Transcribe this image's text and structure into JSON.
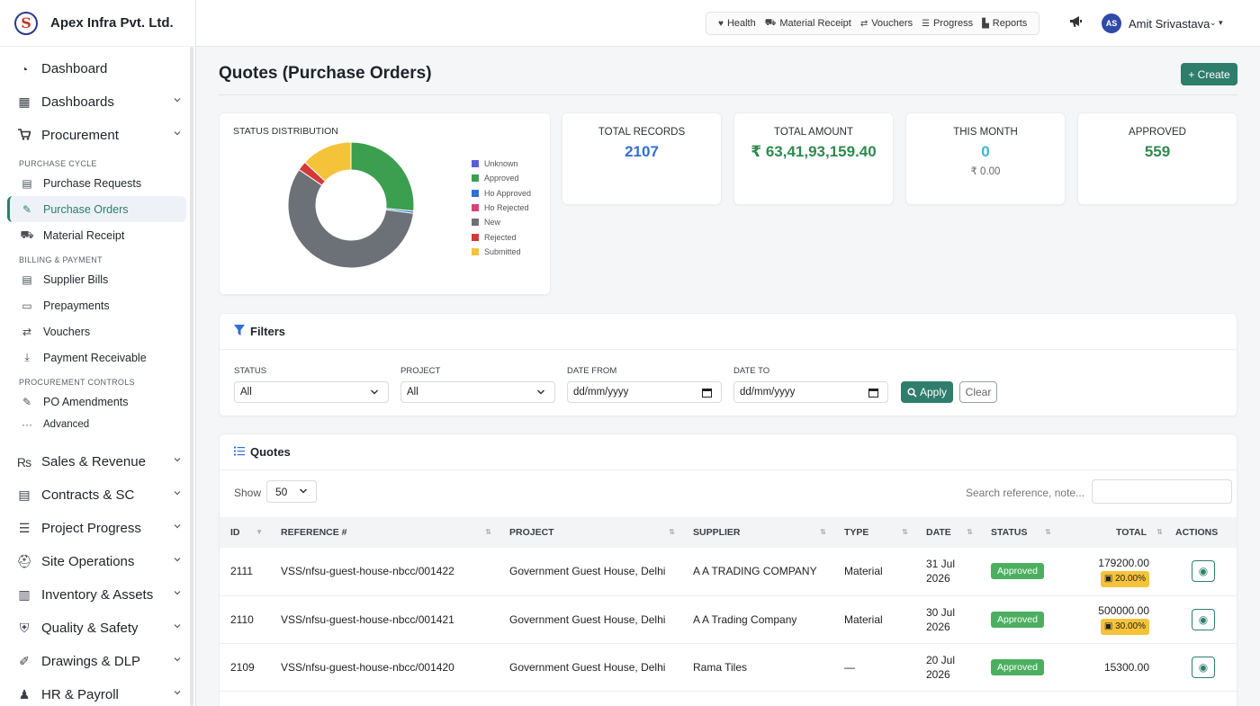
{
  "brand": {
    "name": "Apex Infra Pvt. Ltd.",
    "logo_letter": "S"
  },
  "sidebar": {
    "top": [
      {
        "label": "Dashboard",
        "icon": "gauge-icon",
        "glyph": "◔"
      },
      {
        "label": "Dashboards",
        "icon": "grid-icon",
        "glyph": "▦"
      },
      {
        "label": "Procurement",
        "icon": "cart-icon",
        "glyph": "🛒"
      }
    ],
    "sections": {
      "purchase_cycle": "PURCHASE CYCLE",
      "billing_payment": "BILLING & PAYMENT",
      "procurement_controls": "PROCUREMENT CONTROLS"
    },
    "purchase_cycle_items": [
      {
        "label": "Purchase Requests",
        "glyph": "▤"
      },
      {
        "label": "Purchase Orders",
        "glyph": "✎"
      },
      {
        "label": "Material Receipt",
        "glyph": "⛟"
      }
    ],
    "billing_items": [
      {
        "label": "Supplier Bills",
        "glyph": "▤"
      },
      {
        "label": "Prepayments",
        "glyph": "▭"
      },
      {
        "label": "Vouchers",
        "glyph": "⇄"
      },
      {
        "label": "Payment Receivable",
        "glyph": "⤓"
      }
    ],
    "controls_items": [
      {
        "label": "PO Amendments",
        "glyph": "✎"
      },
      {
        "label": "Advanced",
        "glyph": "···"
      }
    ],
    "bottom": [
      {
        "label": "Sales & Revenue",
        "glyph": "₨"
      },
      {
        "label": "Contracts & SC",
        "glyph": "▤"
      },
      {
        "label": "Project Progress",
        "glyph": "☰"
      },
      {
        "label": "Site Operations",
        "glyph": "⛑"
      },
      {
        "label": "Inventory & Assets",
        "glyph": "▥"
      },
      {
        "label": "Quality & Safety",
        "glyph": "⛨"
      },
      {
        "label": "Drawings & DLP",
        "glyph": "✐"
      },
      {
        "label": "HR & Payroll",
        "glyph": "♟"
      }
    ]
  },
  "header": {
    "quick_links": [
      {
        "label": "Health",
        "glyph": "♥"
      },
      {
        "label": "Material Receipt",
        "glyph": "⛟"
      },
      {
        "label": "Vouchers",
        "glyph": "⇄"
      },
      {
        "label": "Progress",
        "glyph": "☰"
      },
      {
        "label": "Reports",
        "glyph": "▙"
      }
    ],
    "user_initials": "AS",
    "user_name": "Amit Srivastava"
  },
  "page": {
    "title": "Quotes (Purchase Orders)",
    "create_label": "+ Create"
  },
  "status_chart": {
    "title": "STATUS DISTRIBUTION",
    "slices": [
      {
        "label": "Unknown",
        "value": 0,
        "color": "#5b5fd6"
      },
      {
        "label": "Approved",
        "value": 559,
        "color": "#3c9e4f"
      },
      {
        "label": "Ho Approved",
        "value": 12,
        "color": "#2f6fd6"
      },
      {
        "label": "Ho Rejected",
        "value": 0,
        "color": "#d6437a"
      },
      {
        "label": "New",
        "value": 1210,
        "color": "#6c7178"
      },
      {
        "label": "Rejected",
        "value": 50,
        "color": "#d23a3a"
      },
      {
        "label": "Submitted",
        "value": 276,
        "color": "#f5c33a"
      }
    ]
  },
  "stats": [
    {
      "label": "TOTAL RECORDS",
      "value": "2107",
      "color": "#2f6fd6",
      "sub": ""
    },
    {
      "label": "TOTAL AMOUNT",
      "value": "₹ 63,41,93,159.40",
      "color": "#2f8a4e",
      "sub": ""
    },
    {
      "label": "THIS MONTH",
      "value": "0",
      "color": "#3ab4d8",
      "sub": "₹ 0.00"
    },
    {
      "label": "APPROVED",
      "value": "559",
      "color": "#2f8a4e",
      "sub": ""
    }
  ],
  "filters": {
    "title": "Filters",
    "status_label": "STATUS",
    "status_value": "All",
    "project_label": "PROJECT",
    "project_value": "All",
    "date_from_label": "DATE FROM",
    "date_from_placeholder": "dd/mm/yyyy",
    "date_to_label": "DATE TO",
    "date_to_placeholder": "dd/mm/yyyy",
    "apply_label": "Apply",
    "clear_label": "Clear"
  },
  "quotes": {
    "title": "Quotes",
    "show_label": "Show",
    "show_value": "50",
    "search_label": "Search reference, note...",
    "columns": [
      "ID",
      "REFERENCE #",
      "PROJECT",
      "SUPPLIER",
      "TYPE",
      "DATE",
      "STATUS",
      "TOTAL",
      "ACTIONS"
    ],
    "rows": [
      {
        "id": "2111",
        "ref": "VSS/nfsu-guest-house-nbcc/001422",
        "project": "Government Guest House, Delhi",
        "supplier": "A A TRADING COMPANY",
        "type": "Material",
        "date1": "31 Jul",
        "date2": "2026",
        "status": "Approved",
        "total": "179200.00",
        "pct": "20.00%"
      },
      {
        "id": "2110",
        "ref": "VSS/nfsu-guest-house-nbcc/001421",
        "project": "Government Guest House, Delhi",
        "supplier": "A A Trading Company",
        "type": "Material",
        "date1": "30 Jul",
        "date2": "2026",
        "status": "Approved",
        "total": "500000.00",
        "pct": "30.00%"
      },
      {
        "id": "2109",
        "ref": "VSS/nfsu-guest-house-nbcc/001420",
        "project": "Government Guest House, Delhi",
        "supplier": "Rama Tiles",
        "type": "—",
        "date1": "20 Jul",
        "date2": "2026",
        "status": "Approved",
        "total": "15300.00",
        "pct": ""
      }
    ]
  }
}
